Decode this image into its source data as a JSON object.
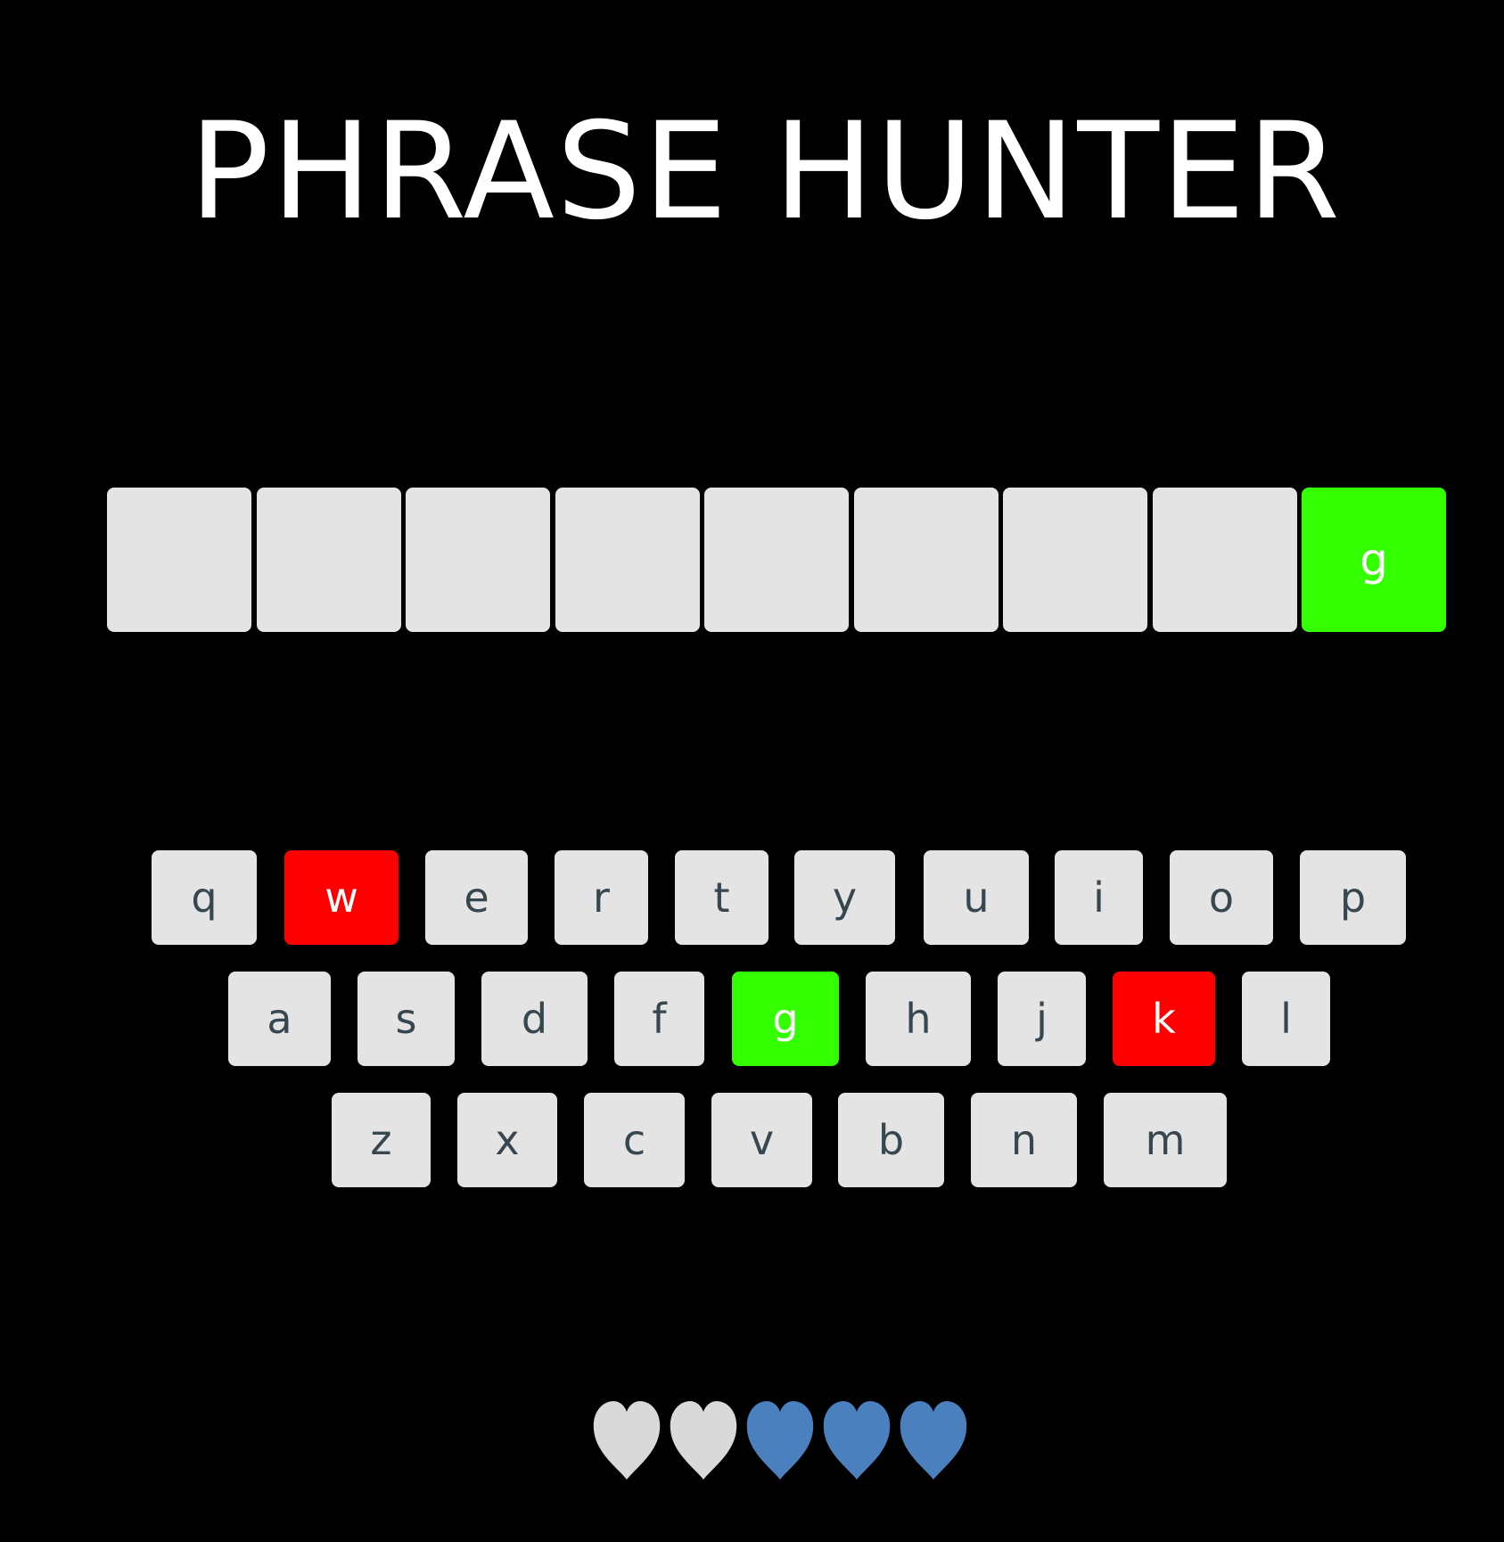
{
  "title": "PHRASE HUNTER",
  "colors": {
    "background": "#000000",
    "tile": "#e4e4e4",
    "correct": "#33ff00",
    "wrong": "#ff0000",
    "life_active": "#4a80bd",
    "life_lost": "#d9d9d9",
    "key_text": "#37474f"
  },
  "phrase": {
    "slots": [
      {
        "letter": "",
        "revealed": false
      },
      {
        "letter": "",
        "revealed": false
      },
      {
        "letter": "",
        "revealed": false
      },
      {
        "letter": "",
        "revealed": false
      },
      {
        "letter": "",
        "revealed": false
      },
      {
        "letter": "",
        "revealed": false
      },
      {
        "letter": "",
        "revealed": false
      },
      {
        "letter": "",
        "revealed": false
      },
      {
        "letter": "g",
        "revealed": true
      }
    ]
  },
  "keyboard": {
    "rows": [
      [
        {
          "key": "q",
          "state": "default"
        },
        {
          "key": "w",
          "state": "wrong"
        },
        {
          "key": "e",
          "state": "default"
        },
        {
          "key": "r",
          "state": "default"
        },
        {
          "key": "t",
          "state": "default"
        },
        {
          "key": "y",
          "state": "default"
        },
        {
          "key": "u",
          "state": "default"
        },
        {
          "key": "i",
          "state": "default"
        },
        {
          "key": "o",
          "state": "default"
        },
        {
          "key": "p",
          "state": "default"
        }
      ],
      [
        {
          "key": "a",
          "state": "default"
        },
        {
          "key": "s",
          "state": "default"
        },
        {
          "key": "d",
          "state": "default"
        },
        {
          "key": "f",
          "state": "default"
        },
        {
          "key": "g",
          "state": "chosen"
        },
        {
          "key": "h",
          "state": "default"
        },
        {
          "key": "j",
          "state": "default"
        },
        {
          "key": "k",
          "state": "wrong"
        },
        {
          "key": "l",
          "state": "default"
        }
      ],
      [
        {
          "key": "z",
          "state": "default"
        },
        {
          "key": "x",
          "state": "default"
        },
        {
          "key": "c",
          "state": "default"
        },
        {
          "key": "v",
          "state": "default"
        },
        {
          "key": "b",
          "state": "default"
        },
        {
          "key": "n",
          "state": "default"
        },
        {
          "key": "m",
          "state": "default"
        }
      ]
    ]
  },
  "lives": {
    "total": 5,
    "remaining": 3,
    "hearts": [
      "lost",
      "lost",
      "active",
      "active",
      "active"
    ]
  }
}
